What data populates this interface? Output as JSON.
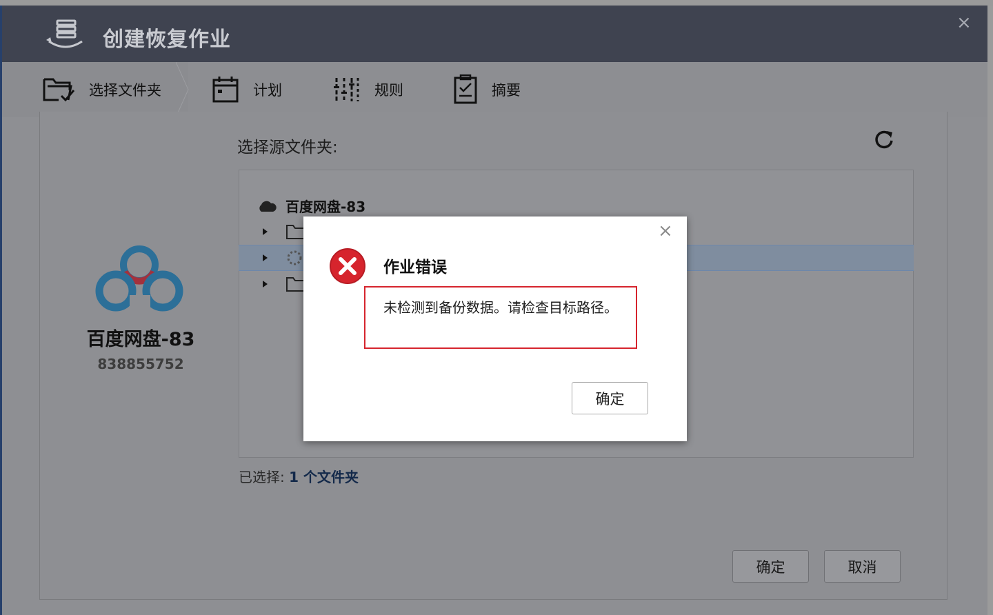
{
  "window": {
    "title": "创建恢复作业",
    "close": "×"
  },
  "steps": [
    {
      "label": "选择文件夹",
      "icon": "folder-check-icon",
      "active": true
    },
    {
      "label": "计划",
      "icon": "calendar-icon"
    },
    {
      "label": "规则",
      "icon": "sliders-icon"
    },
    {
      "label": "摘要",
      "icon": "clipboard-icon"
    }
  ],
  "source": {
    "label": "选择源文件夹:",
    "refresh_icon": "refresh-icon"
  },
  "tree": {
    "root_label": "百度网盘-83",
    "root_icon": "cloud-icon"
  },
  "account": {
    "name": "百度网盘-83",
    "id": "838855752",
    "logo": "baidu-netdisk-logo"
  },
  "selection": {
    "prefix": "已选择: ",
    "count_text": "1 个文件夹"
  },
  "buttons": {
    "ok": "确定",
    "cancel": "取消"
  },
  "dialog": {
    "close": "×",
    "title": "作业错误",
    "message": "未检测到备份数据。请检查目标路径。",
    "ok": "确定",
    "icon": "error-icon"
  },
  "colors": {
    "titlebar": "#3f4350",
    "error_red": "#d6242d",
    "selection_row": "#7f8d9f"
  }
}
